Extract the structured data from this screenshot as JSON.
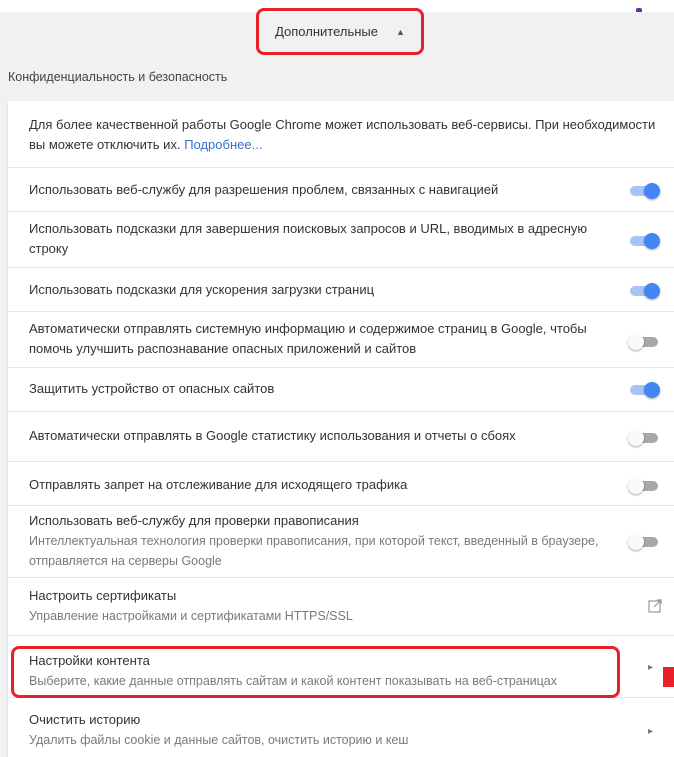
{
  "header": {
    "advanced_label": "Дополнительные",
    "caret": "▲"
  },
  "section_title": "Конфиденциальность и безопасность",
  "intro": {
    "text": "Для более качественной работы Google Chrome может использовать веб-сервисы. При необходимости вы можете отключить их.",
    "link": "Подробнее..."
  },
  "toggles": [
    {
      "label": "Использовать веб-службу для разрешения проблем, связанных с навигацией",
      "state": "on"
    },
    {
      "label": "Использовать подсказки для завершения поисковых запросов и URL, вводимых в адресную строку",
      "state": "on"
    },
    {
      "label": "Использовать подсказки для ускорения загрузки страниц",
      "state": "on"
    },
    {
      "label": "Автоматически отправлять системную информацию и содержимое страниц в Google, чтобы помочь улучшить распознавание опасных приложений и сайтов",
      "state": "off"
    },
    {
      "label": "Защитить устройство от опасных сайтов",
      "state": "on"
    },
    {
      "label": "Автоматически отправлять в Google статистику использования и отчеты о сбоях",
      "state": "off"
    },
    {
      "label": "Отправлять запрет на отслеживание для исходящего трафика",
      "state": "off"
    },
    {
      "label": "Использовать веб-службу для проверки правописания",
      "sub": "Интеллектуальная технология проверки правописания, при которой текст, введенный в браузере, отправляется на серверы Google",
      "state": "off"
    }
  ],
  "links": [
    {
      "label": "Настроить сертификаты",
      "sub": "Управление настройками и сертификатами HTTPS/SSL",
      "icon": "external-link-icon"
    },
    {
      "label": "Настройки контента",
      "sub": "Выберите, какие данные отправлять сайтам и какой контент показывать на веб-страницах",
      "icon": "chevron-right-icon"
    },
    {
      "label": "Очистить историю",
      "sub": "Удалить файлы cookie и данные сайтов, очистить историю и кеш",
      "icon": "chevron-right-icon"
    }
  ],
  "colors": {
    "accent": "#4285f4",
    "highlight": "#e8202a",
    "link": "#3b6fd1"
  }
}
